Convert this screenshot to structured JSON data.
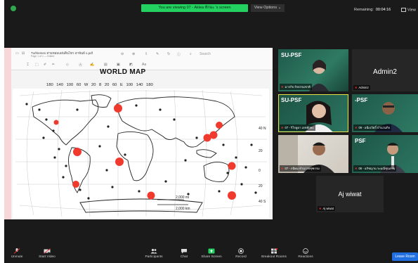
{
  "topbar": {
    "viewing_banner": "You are viewing 07 - Aklea ทักษะ 's screen",
    "view_options": "View Options ⌄",
    "remaining_label": "Remaining:",
    "remaining_time": "00:04:16",
    "view_label": "View"
  },
  "document": {
    "title": "Tu/themes สามหอมแผ่นดินไหว อาพันธ์ s.pdf",
    "subtitle": "Page 1 of 1 — Edited",
    "search_placeholder": "Search",
    "map_title": "WORLD MAP",
    "longitudes": "180 140 100 60 W 20 8 20 60 E 100 140 180",
    "lat_labels": [
      "40 N",
      "20",
      "0",
      "20",
      "40 S"
    ],
    "scale_miles": "2,000 mi",
    "scale_km": "2,000 km"
  },
  "participants": [
    {
      "name": "SU-PSF",
      "caption": "มากกิจ ถิรธรรมชาติ",
      "type": "video"
    },
    {
      "name": "Admin2",
      "caption": "Admin2",
      "type": "name"
    },
    {
      "name": "SU-PSF",
      "caption": "07 - ริโรดูดา เลขทักษะ",
      "type": "video"
    },
    {
      "name": "-PSF",
      "caption": "09 - อนีเจวัตถิ์ บำนวนกิจ",
      "type": "video"
    },
    {
      "name": "",
      "caption": "07 - กนีคม ทำนวรยชุฑกรม",
      "type": "video"
    },
    {
      "name": "PSF",
      "caption": "06 - อภิชญาน ระมณีชุณกรม",
      "type": "video"
    },
    {
      "name": "Aj wiwat",
      "caption": "Aj wiwat",
      "type": "name"
    }
  ],
  "bottombar": {
    "unmute": "Unmute",
    "start_video": "Start Video",
    "participants": "Participants",
    "participants_count": "7",
    "chat": "Chat",
    "share_screen": "Share Screen",
    "record": "Record",
    "breakout_rooms": "Breakout Rooms",
    "reactions": "Reactions",
    "leave": "Leave Room"
  },
  "colors": {
    "accent": "#23d160",
    "leave": "#1f6fe0",
    "marker": "#f03a2e",
    "active_speaker": "#e8e24a"
  }
}
